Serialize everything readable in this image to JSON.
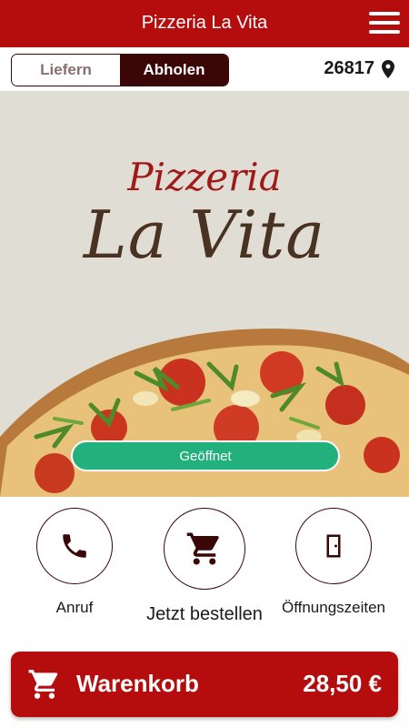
{
  "header": {
    "title": "Pizzeria La Vita",
    "menu_icon": "hamburger-menu-icon"
  },
  "delivery_toggle": {
    "options": [
      "Liefern",
      "Abholen"
    ],
    "selected": "Abholen"
  },
  "location": {
    "zip": "26817",
    "icon": "map-pin-icon"
  },
  "hero": {
    "logo_line1": "Pizzeria",
    "logo_line2": "La Vita",
    "status_label": "Geöffnet"
  },
  "actions": [
    {
      "label": "Anruf",
      "icon": "phone-icon"
    },
    {
      "label": "Jetzt bestellen",
      "icon": "shopping-cart-icon"
    },
    {
      "label": "Öffnungszeiten",
      "icon": "door-icon"
    }
  ],
  "cart": {
    "label": "Warenkorb",
    "total": "28,50 €",
    "icon": "shopping-cart-icon"
  },
  "colors": {
    "brand_red": "#b50d0d",
    "dark_maroon": "#3a0606",
    "open_green": "#22b07d"
  }
}
